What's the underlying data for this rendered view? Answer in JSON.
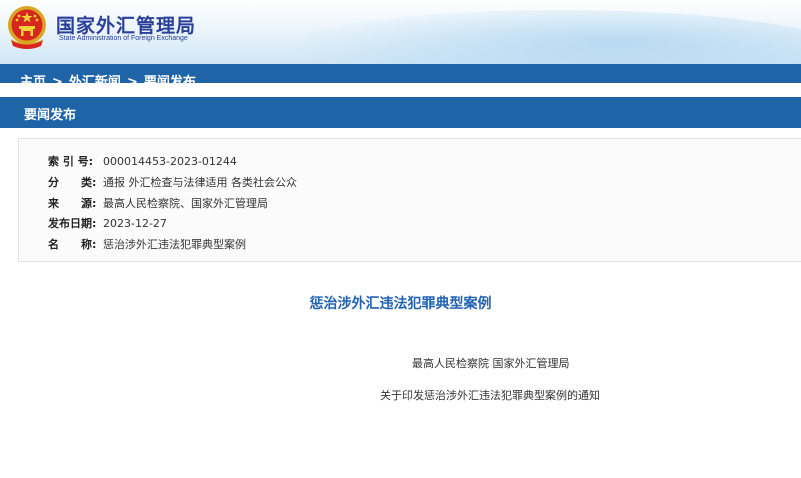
{
  "header": {
    "site_name_cn": "国家外汇管理局",
    "site_name_en": "State Administration of Foreign Exchange"
  },
  "breadcrumb": {
    "items": [
      "主页",
      "外汇新闻",
      "要闻发布"
    ],
    "separator": ">"
  },
  "section": {
    "title": "要闻发布"
  },
  "meta": {
    "rows": [
      {
        "label": "索 引 号:",
        "value": "000014453-2023-01244"
      },
      {
        "label": "分　　类:",
        "value": "通报  外汇检查与法律适用  各类社会公众"
      },
      {
        "label": "来　　源:",
        "value": "最高人民检察院、国家外汇管理局"
      },
      {
        "label": "发布日期:",
        "value": "2023-12-27"
      },
      {
        "label": "名　　称:",
        "value": "惩治涉外汇违法犯罪典型案例"
      }
    ]
  },
  "article": {
    "title": "惩治涉外汇违法犯罪典型案例",
    "issuers": "最高人民检察院   国家外汇管理局",
    "notice": "关于印发惩治涉外汇违法犯罪典型案例的通知"
  },
  "colors": {
    "brand_blue": "#1f64a6",
    "title_blue": "#2063b1",
    "logo_text": "#2a3f9a"
  },
  "icons": {
    "emblem": "national-emblem-icon"
  }
}
